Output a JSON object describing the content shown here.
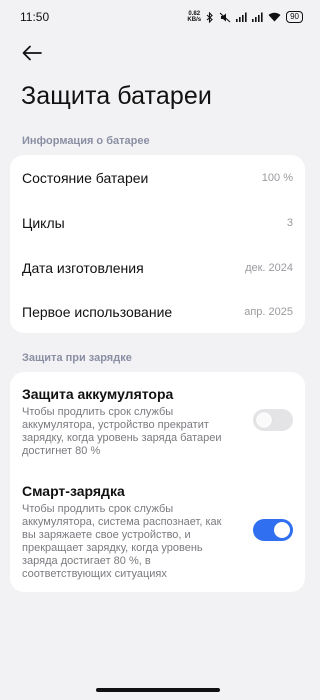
{
  "status_bar": {
    "time": "11:50",
    "net_speed_value": "0.82",
    "net_speed_unit": "KB/s",
    "battery": "90"
  },
  "page": {
    "title": "Защита батареи"
  },
  "info_section": {
    "header": "Информация о батарее",
    "rows": [
      {
        "label": "Состояние батареи",
        "value": "100 %"
      },
      {
        "label": "Циклы",
        "value": "3"
      },
      {
        "label": "Дата изготовления",
        "value": "дек. 2024"
      },
      {
        "label": "Первое использование",
        "value": "апр. 2025"
      }
    ]
  },
  "charging_section": {
    "header": "Защита при зарядке",
    "items": [
      {
        "title": "Защита аккумулятора",
        "description": "Чтобы продлить срок службы аккумулятора, устройство прекратит зарядку, когда уровень заряда батареи достигнет 80 %",
        "enabled": false
      },
      {
        "title": "Смарт-зарядка",
        "description": "Чтобы продлить срок службы аккумулятора, система распознает, как вы заряжаете свое устройство, и прекращает зарядку, когда уровень заряда достигает 80 %, в соответствующих ситуациях",
        "enabled": true
      }
    ]
  },
  "colors": {
    "accent": "#2f6ff0",
    "background": "#f2f2f4",
    "card": "#ffffff",
    "section_header": "#8a8fa3"
  },
  "icons": [
    "back-arrow-icon",
    "bluetooth-icon",
    "mute-icon",
    "signal-icon",
    "wifi-icon",
    "battery-icon"
  ]
}
